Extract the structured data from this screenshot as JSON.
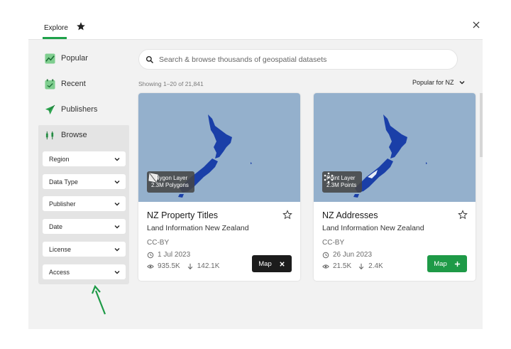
{
  "header": {
    "tab_explore": "Explore",
    "favorites_icon": "star-icon",
    "close_icon": "close-icon"
  },
  "sidebar": {
    "items": [
      {
        "label": "Popular",
        "icon": "chart-icon"
      },
      {
        "label": "Recent",
        "icon": "calendar-icon"
      },
      {
        "label": "Publishers",
        "icon": "send-icon"
      },
      {
        "label": "Browse",
        "icon": "browse-icon"
      }
    ],
    "filters": [
      {
        "label": "Region"
      },
      {
        "label": "Data Type"
      },
      {
        "label": "Publisher"
      },
      {
        "label": "Date"
      },
      {
        "label": "License"
      },
      {
        "label": "Access"
      }
    ]
  },
  "search": {
    "placeholder": "Search & browse thousands of geospatial datasets",
    "value": ""
  },
  "results": {
    "count_text": "Showing 1–20 of 21,841",
    "sort_label": "Popular for NZ"
  },
  "cards": [
    {
      "layer_type": "Polygon Layer",
      "layer_count": "2.3M Polygons",
      "title": "NZ Property Titles",
      "publisher": "Land Information New Zealand",
      "license": "CC-BY",
      "date": "1 Jul 2023",
      "views": "935.5K",
      "downloads": "142.1K",
      "button_label": "Map",
      "button_state": "added"
    },
    {
      "layer_type": "Point Layer",
      "layer_count": "2.3M Points",
      "title": "NZ Addresses",
      "publisher": "Land Information New Zealand",
      "license": "CC-BY",
      "date": "26 Jun 2023",
      "views": "21.5K",
      "downloads": "2.4K",
      "button_label": "Map",
      "button_state": "not-added"
    }
  ],
  "colors": {
    "accent_green": "#1ea14a",
    "map_water": "#94b0cc",
    "map_land": "#1a3fa8",
    "button_dark": "#1c1c1c"
  }
}
